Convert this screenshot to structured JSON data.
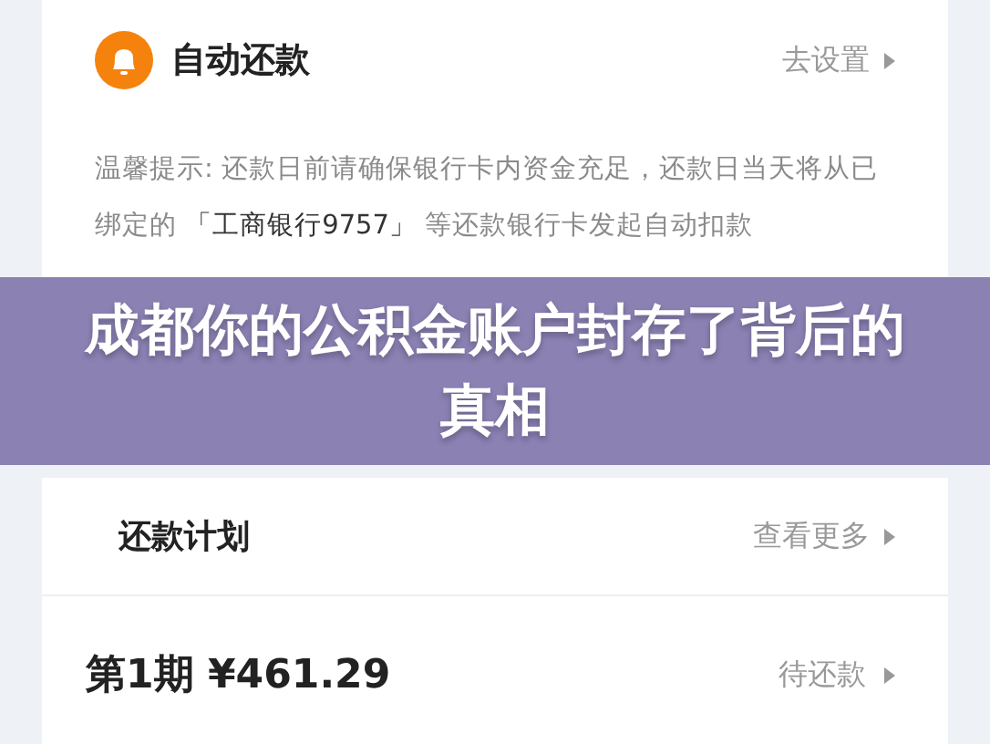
{
  "auto_repay": {
    "title": "自动还款",
    "action": "去设置",
    "tip": {
      "before": "温馨提示: 还款日前请确保银行卡内资金充足，还款日当天将从已绑定的 ",
      "bank": "「工商银行9757」",
      "after": " 等还款银行卡发起自动扣款"
    }
  },
  "banner": {
    "title": "成都你的公积金账户封存了背后的真相"
  },
  "plan": {
    "title": "还款计划",
    "action": "查看更多",
    "installments": [
      {
        "label": "第1期 ¥461.29",
        "status": "待还款"
      }
    ]
  }
}
